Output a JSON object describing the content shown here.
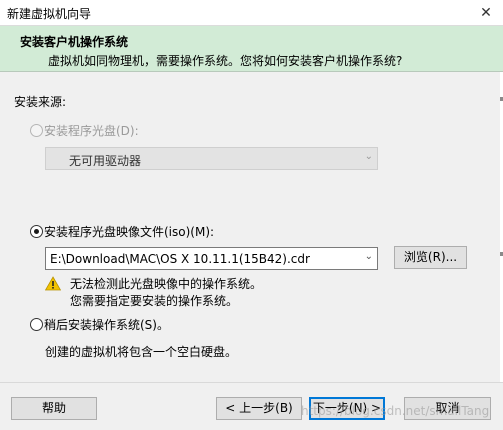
{
  "window": {
    "title": "新建虚拟机向导",
    "close_glyph": "✕"
  },
  "header": {
    "title": "安装客户机操作系统",
    "subtitle": "虚拟机如同物理机，需要操作系统。您将如何安装客户机操作系统?"
  },
  "source": {
    "label": "安装来源:",
    "disc": {
      "label": "安装程序光盘(D):",
      "selected": false,
      "enabled": false,
      "drive_value": "无可用驱动器"
    },
    "iso": {
      "label": "安装程序光盘映像文件(iso)(M):",
      "selected": true,
      "path_value": "E:\\Download\\MAC\\OS X 10.11.1(15B42).cdr",
      "browse_label": "浏览(R)...",
      "warning_line1": "无法检测此光盘映像中的操作系统。",
      "warning_line2": "您需要指定要安装的操作系统。"
    },
    "later": {
      "label": "稍后安装操作系统(S)。",
      "selected": false,
      "description": "创建的虚拟机将包含一个空白硬盘。"
    }
  },
  "footer": {
    "help_label": "帮助",
    "back_label": "< 上一步(B)",
    "next_label": "下一步(N) >",
    "cancel_label": "取消"
  },
  "watermark": "https://blog.csdn.net/smallTang",
  "colors": {
    "header_bg": "#d2ebd6",
    "warning": "#f2c200"
  }
}
